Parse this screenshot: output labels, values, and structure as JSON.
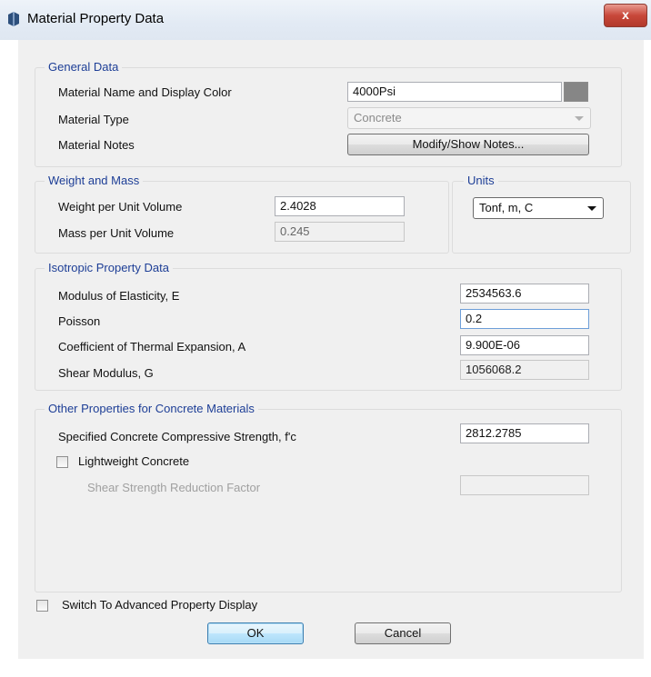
{
  "window": {
    "title": "Material Property Data",
    "close_label": "x"
  },
  "general": {
    "legend": "General Data",
    "name_label": "Material Name and Display Color",
    "name_value": "4000Psi",
    "display_color": "#868686",
    "type_label": "Material Type",
    "type_value": "Concrete",
    "notes_label": "Material Notes",
    "notes_button": "Modify/Show Notes..."
  },
  "weight_mass": {
    "legend": "Weight and Mass",
    "weight_label": "Weight per Unit Volume",
    "weight_value": "2.4028",
    "mass_label": "Mass per Unit Volume",
    "mass_value": "0.245"
  },
  "units": {
    "legend": "Units",
    "value": "Tonf, m, C"
  },
  "isotropic": {
    "legend": "Isotropic Property Data",
    "modulus_label": "Modulus of Elasticity,  E",
    "modulus_value": "2534563.6",
    "poisson_label": "Poisson",
    "poisson_value": "0.2",
    "thermal_label": "Coefficient of Thermal Expansion,  A",
    "thermal_value": "9.900E-06",
    "shear_label": "Shear Modulus,  G",
    "shear_value": "1056068.2"
  },
  "concrete": {
    "legend": "Other Properties for Concrete Materials",
    "fc_label": "Specified Concrete Compressive Strength, f'c",
    "fc_value": "2812.2785",
    "lightweight_label": "Lightweight Concrete",
    "lightweight_checked": false,
    "shear_reduction_label": "Shear Strength Reduction Factor",
    "shear_reduction_value": ""
  },
  "advanced": {
    "label": "Switch To Advanced Property Display",
    "checked": false
  },
  "buttons": {
    "ok": "OK",
    "cancel": "Cancel"
  }
}
